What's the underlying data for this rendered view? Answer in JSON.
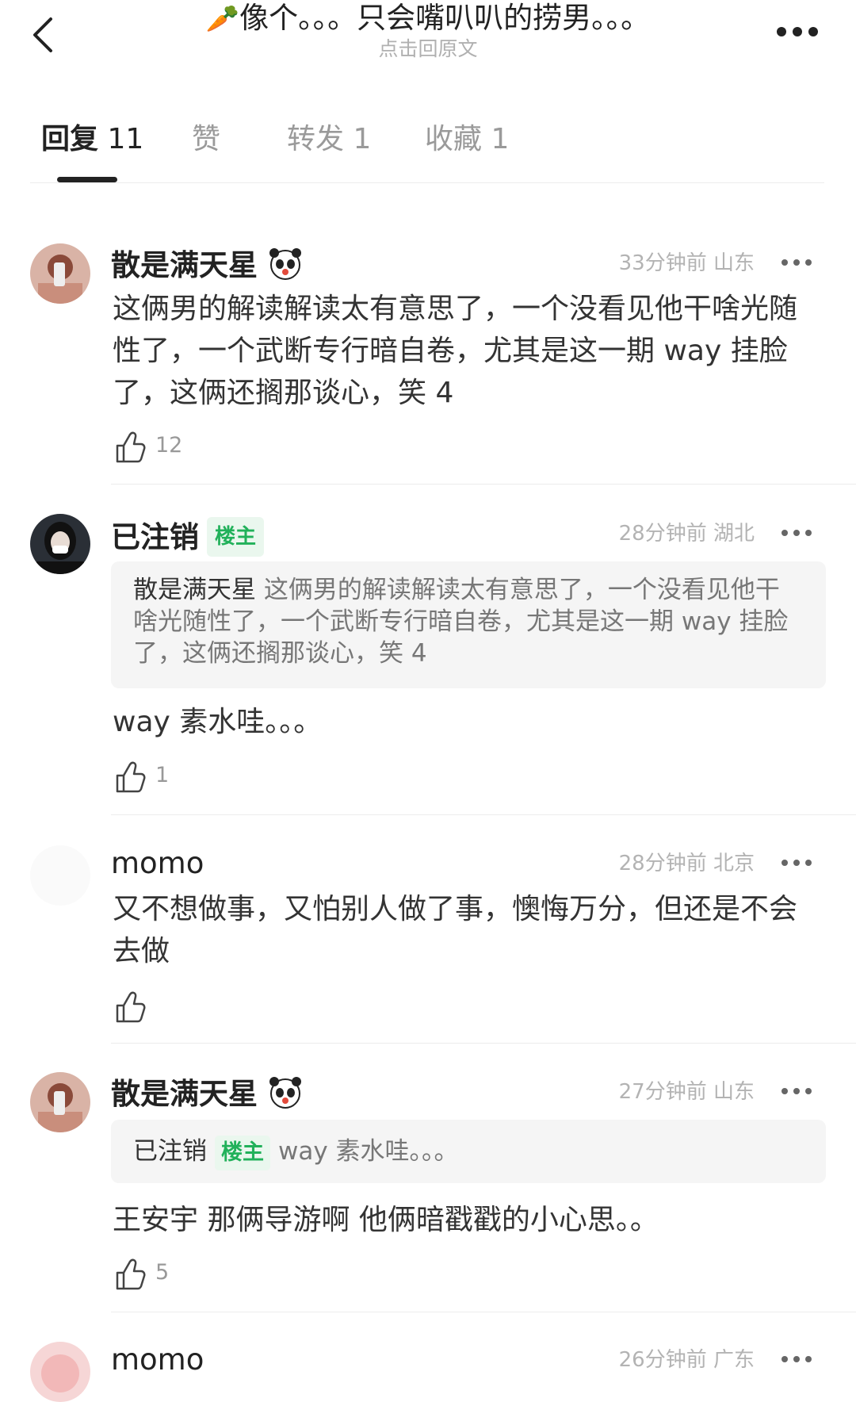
{
  "header": {
    "title_emoji": "🥕",
    "title": "像个。。。只会嘴叭叭的捞男。。。",
    "subtitle": "点击回原文"
  },
  "tabs": [
    {
      "label": "回复",
      "count": "11"
    },
    {
      "label": "赞",
      "count": ""
    },
    {
      "label": "转发",
      "count": "1"
    },
    {
      "label": "收藏",
      "count": "1"
    }
  ],
  "comments": [
    {
      "username": "散是满天星",
      "time": "33分钟前",
      "location": "山东",
      "content": "这俩男的解读解读太有意思了，一个没看见他干啥光随性了，一个武断专行暗自卷，尤其是这一期 way 挂脸了，这俩还搁那谈心，笑 4",
      "likes": "12"
    },
    {
      "username": "已注销",
      "badge": "楼主",
      "time": "28分钟前",
      "location": "湖北",
      "quote_author": "散是满天星",
      "quote_text": "这俩男的解读解读太有意思了，一个没看见他干啥光随性了，一个武断专行暗自卷，尤其是这一期 way 挂脸了，这俩还搁那谈心，笑 4",
      "content": "way 素水哇。。。",
      "likes": "1"
    },
    {
      "username": "momo",
      "time": "28分钟前",
      "location": "北京",
      "content": "又不想做事，又怕别人做了事，懊悔万分，但还是不会去做",
      "likes": ""
    },
    {
      "username": "散是满天星",
      "time": "27分钟前",
      "location": "山东",
      "quote_author": "已注销",
      "quote_badge": "楼主",
      "quote_text": "way 素水哇。。。",
      "content": "王安宇 那俩导游啊 他俩暗戳戳的小心思。。",
      "likes": "5"
    },
    {
      "username": "momo",
      "time": "26分钟前",
      "location": "广东"
    }
  ],
  "colors": {
    "owner_badge": "#21b15a",
    "meta_text": "#b3b3b3",
    "quote_bg": "#f5f5f5"
  }
}
